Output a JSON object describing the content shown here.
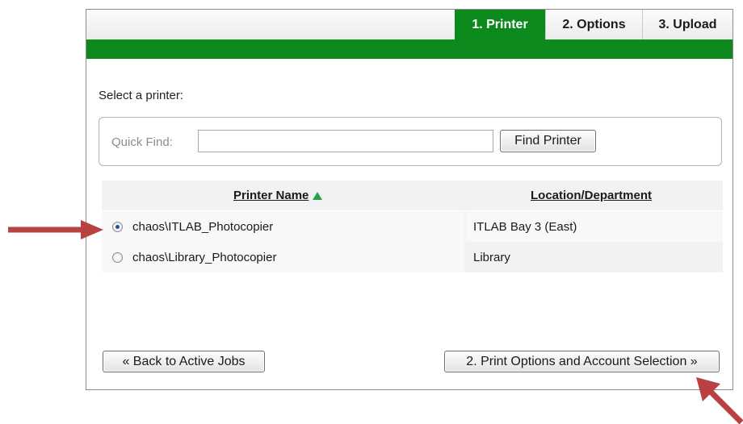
{
  "tabs": [
    {
      "label": "1. Printer",
      "active": true
    },
    {
      "label": "2. Options",
      "active": false
    },
    {
      "label": "3. Upload",
      "active": false
    }
  ],
  "select_label": "Select a printer:",
  "quick_find": {
    "label": "Quick Find:",
    "value": "",
    "placeholder": "",
    "button_label": "Find Printer"
  },
  "table": {
    "headers": {
      "name": "Printer Name",
      "location": "Location/Department",
      "sort_icon": "sort-ascending-icon"
    },
    "rows": [
      {
        "name": "chaos\\ITLAB_Photocopier",
        "location": "ITLAB Bay 3 (East)",
        "selected": true
      },
      {
        "name": "chaos\\Library_Photocopier",
        "location": "Library",
        "selected": false
      }
    ]
  },
  "buttons": {
    "back": "« Back to Active Jobs",
    "next": "2. Print Options and Account Selection »"
  },
  "colors": {
    "accent_green": "#0d8a1e",
    "sort_arrow": "#2aa04a",
    "annotation_arrow": "#b84141"
  },
  "annotations": [
    "arrow-right-icon",
    "arrow-up-left-icon"
  ]
}
